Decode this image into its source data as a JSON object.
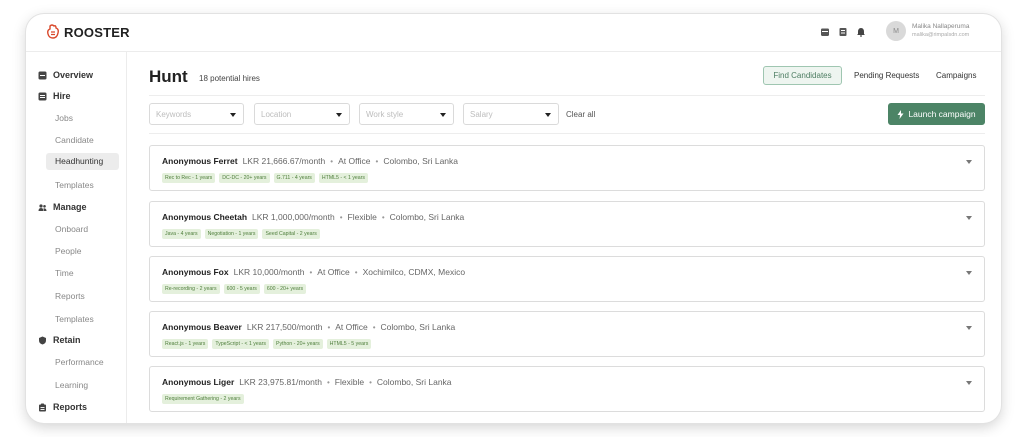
{
  "app": {
    "logo": "ROOSTER"
  },
  "user": {
    "initials": "M",
    "name": "Malika Nallaperuma",
    "email": "malika@rimpalsdn.com"
  },
  "sidebar": {
    "groups": [
      {
        "label": "Overview",
        "icon": "overview-icon"
      },
      {
        "label": "Hire",
        "icon": "hire-icon",
        "items": [
          "Jobs",
          "Candidate",
          "Headhunting",
          "Templates"
        ]
      },
      {
        "label": "Manage",
        "icon": "users-icon",
        "items": [
          "Onboard",
          "People",
          "Time",
          "Reports",
          "Templates"
        ]
      },
      {
        "label": "Retain",
        "icon": "shield-icon",
        "items": [
          "Performance",
          "Learning"
        ]
      },
      {
        "label": "Reports",
        "icon": "clipboard-icon"
      }
    ],
    "active": "Headhunting"
  },
  "header": {
    "title": "Hunt",
    "subtitle": "18 potential hires"
  },
  "actions": {
    "find": "Find Candidates",
    "pending": "Pending Requests",
    "campaigns": "Campaigns"
  },
  "filters": {
    "keywords": "Keywords",
    "location": "Location",
    "work_style": "Work style",
    "salary": "Salary",
    "clear": "Clear all",
    "launch": "Launch campaign"
  },
  "colors": {
    "accent": "#4c8466",
    "tag_bg": "#e4f0dc",
    "tag_text": "#4e7e3b"
  },
  "candidates": [
    {
      "name": "Anonymous Ferret",
      "salary": "LKR 21,666.67/month",
      "style": "At Office",
      "location": "Colombo, Sri Lanka",
      "tags": [
        "Rec to Rec - 1 years",
        "DC-DC - 20+ years",
        "G.711 - 4 years",
        "HTML5 - < 1 years"
      ]
    },
    {
      "name": "Anonymous Cheetah",
      "salary": "LKR 1,000,000/month",
      "style": "Flexible",
      "location": "Colombo, Sri Lanka",
      "tags": [
        "Java - 4 years",
        "Negotiation - 1 years",
        "Seed Capital - 2 years"
      ]
    },
    {
      "name": "Anonymous Fox",
      "salary": "LKR 10,000/month",
      "style": "At Office",
      "location": "Xochimilco, CDMX, Mexico",
      "tags": [
        "Re-recording - 2 years",
        "600 - 5 years",
        "600 - 20+ years"
      ]
    },
    {
      "name": "Anonymous Beaver",
      "salary": "LKR 217,500/month",
      "style": "At Office",
      "location": "Colombo, Sri Lanka",
      "tags": [
        "React.js - 1 years",
        "TypeScript - < 1 years",
        "Python - 20+ years",
        "HTML5 - 5 years"
      ]
    },
    {
      "name": "Anonymous Liger",
      "salary": "LKR 23,975.81/month",
      "style": "Flexible",
      "location": "Colombo, Sri Lanka",
      "tags": [
        "Requirement Gathering - 2 years"
      ]
    }
  ]
}
